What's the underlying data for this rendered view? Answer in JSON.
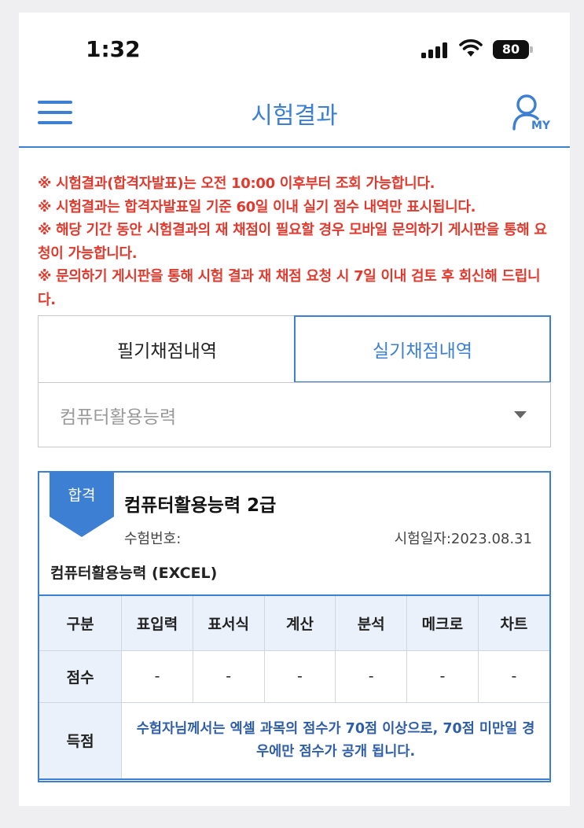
{
  "status_bar": {
    "time": "1:32",
    "battery": "80",
    "icons": [
      "signal-icon",
      "wifi-icon",
      "battery-icon"
    ]
  },
  "header": {
    "title": "시험결과",
    "my_label": "MY",
    "icons": [
      "hamburger-menu-icon",
      "user-my-icon"
    ],
    "accent_color": "#3d7fd3"
  },
  "notices": [
    "※ 시험결과(합격자발표)는 오전 10:00 이후부터 조회 가능합니다.",
    "※ 시험결과는 합격자발표일 기준 60일 이내 실기 점수 내역만 표시됩니다.",
    "※ 해당 기간 동안 시험결과의 재 채점이 필요할 경우 모바일 문의하기 게시판을 통해 요청이 가능합니다.",
    "※ 문의하기 게시판을 통해 시험 결과 재 채점 요청 시 7일 이내 검토 후 회신해 드립니다."
  ],
  "notice_color": "#e03a2f",
  "tabs": {
    "written": "필기채점내역",
    "practical": "실기채점내역",
    "selected": "practical"
  },
  "select": {
    "value": "컴퓨터활용능력"
  },
  "result": {
    "badge": "합격",
    "exam_name": "컴퓨터활용능력 2급",
    "exam_number_label": "수험번호:",
    "exam_date": "시험일자:2023.08.31",
    "subject": "컴퓨터활용능력 (EXCEL)",
    "table": {
      "headers": [
        "구분",
        "표입력",
        "표서식",
        "계산",
        "분석",
        "메크로",
        "차트"
      ],
      "score_label": "점수",
      "scores": [
        "-",
        "-",
        "-",
        "-",
        "-",
        "-"
      ],
      "grade_label": "득점",
      "grade_notice": "수험자님께서는 엑셀 과목의 점수가 70점 이상으로, 70점 미만일 경우에만 점수가 공개 됩니다."
    }
  }
}
